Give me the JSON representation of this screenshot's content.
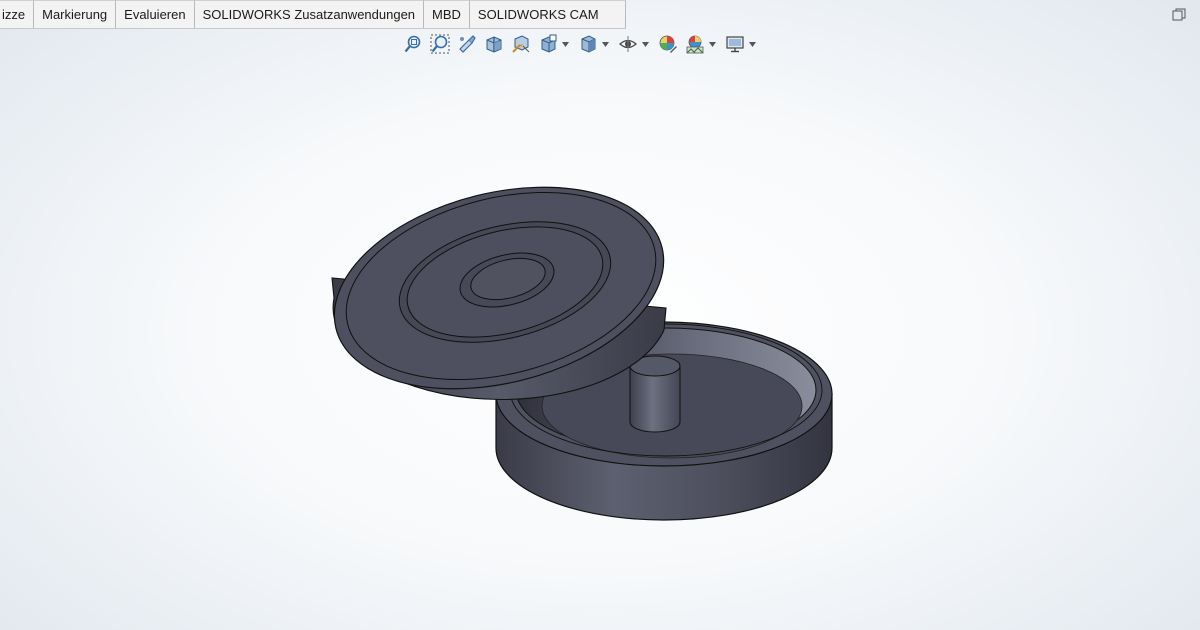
{
  "command_manager": {
    "tabs": [
      {
        "label": "izze"
      },
      {
        "label": "Markierung"
      },
      {
        "label": "Evaluieren"
      },
      {
        "label": "SOLIDWORKS Zusatzanwendungen"
      },
      {
        "label": "MBD"
      },
      {
        "label": "SOLIDWORKS CAM"
      }
    ]
  },
  "heads_up_toolbar": {
    "buttons": [
      {
        "icon": "zoom-to-fit-icon"
      },
      {
        "icon": "zoom-to-area-icon"
      },
      {
        "icon": "previous-view-icon"
      },
      {
        "icon": "section-view-icon"
      },
      {
        "icon": "dynamic-annotation-views-icon"
      },
      {
        "icon": "view-orientation-icon"
      },
      {
        "icon": "display-style-icon"
      },
      {
        "icon": "hide-show-items-icon"
      },
      {
        "icon": "edit-appearance-icon"
      },
      {
        "icon": "apply-scene-icon"
      },
      {
        "icon": "view-settings-icon"
      }
    ]
  },
  "graphics_area": {
    "model": "cylindrical-container-with-lid",
    "part_color": "#4d4f5e",
    "background_center": "#ffffff",
    "background_edge": "#dde4eb"
  }
}
